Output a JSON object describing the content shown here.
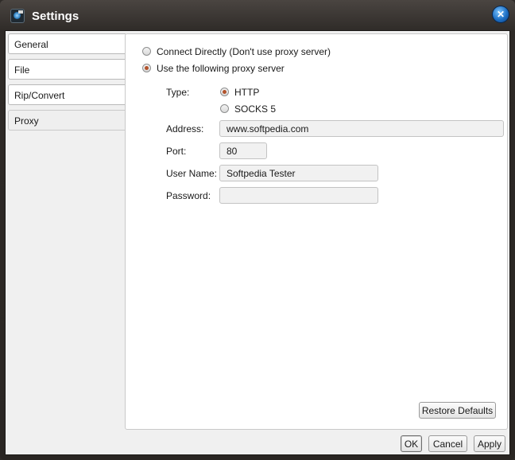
{
  "window": {
    "title": "Settings"
  },
  "tabs": [
    {
      "label": "General"
    },
    {
      "label": "File"
    },
    {
      "label": "Rip/Convert"
    },
    {
      "label": "Proxy"
    }
  ],
  "active_tab": "Proxy",
  "proxy": {
    "connect_directly_label": "Connect Directly (Don't use proxy server)",
    "use_proxy_label": "Use the following proxy server",
    "mode_selected": "use_proxy",
    "type_label": "Type:",
    "type_options": [
      {
        "label": "HTTP"
      },
      {
        "label": "SOCKS 5"
      }
    ],
    "type_selected": "HTTP",
    "address_label": "Address:",
    "address_value": "www.softpedia.com",
    "port_label": "Port:",
    "port_value": "80",
    "username_label": "User Name:",
    "username_value": "Softpedia Tester",
    "password_label": "Password:",
    "password_value": ""
  },
  "buttons": {
    "restore_defaults": "Restore Defaults",
    "ok": "OK",
    "cancel": "Cancel",
    "apply": "Apply"
  },
  "icons": {
    "app": "app-logo-icon",
    "close": "close-icon"
  }
}
